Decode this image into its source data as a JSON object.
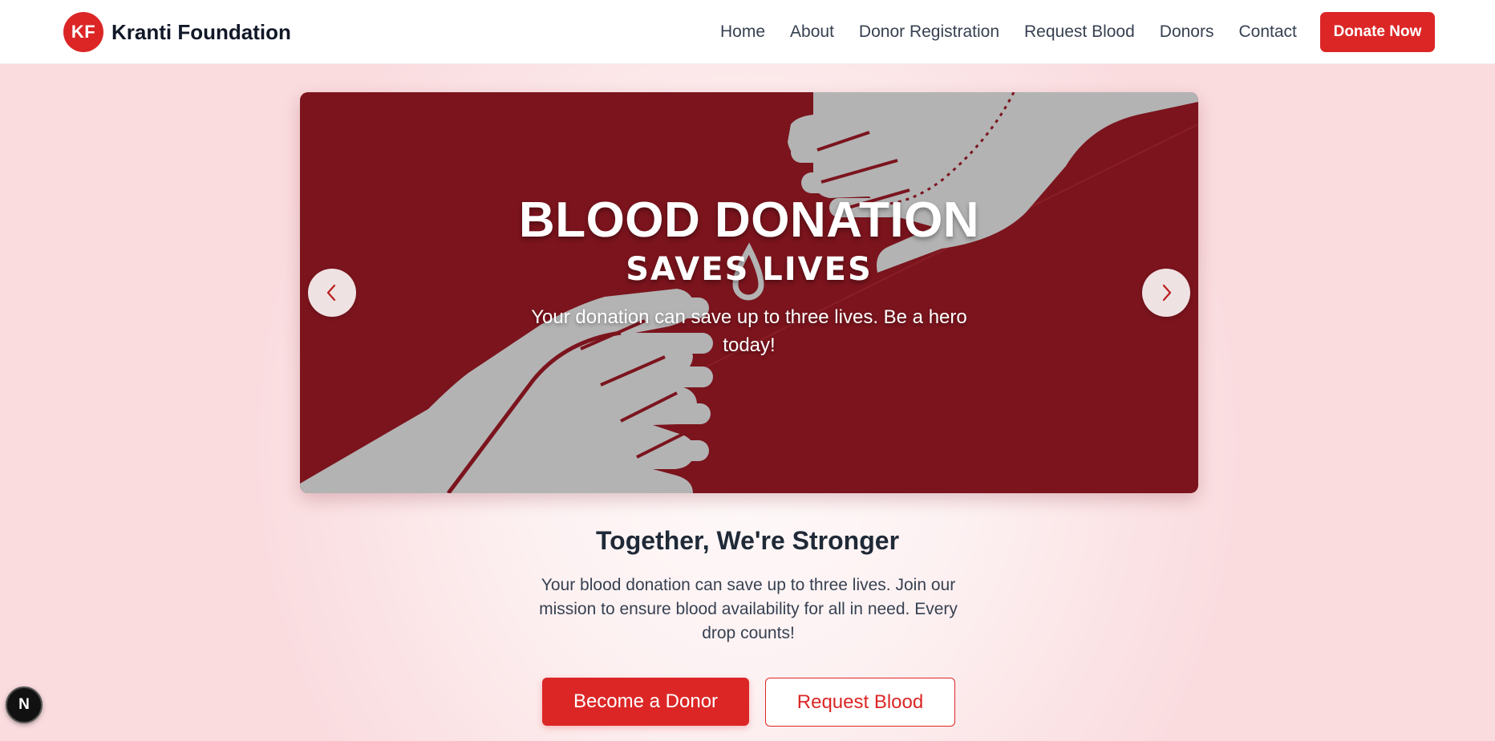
{
  "header": {
    "logo_text": "KF",
    "brand_name": "Kranti Foundation",
    "nav": [
      "Home",
      "About",
      "Donor Registration",
      "Request Blood",
      "Donors",
      "Contact"
    ],
    "cta_label": "Donate Now"
  },
  "hero": {
    "title": "BLOOD DONATION",
    "subtitle": "SAVES LIVES",
    "description": "Your donation can save up to three lives. Be a hero today!",
    "prev_icon": "chevron-left-icon",
    "next_icon": "chevron-right-icon"
  },
  "mission": {
    "title": "Together, We're Stronger",
    "text": "Your blood donation can save up to three lives. Join our mission to ensure blood availability for all in need. Every drop counts!",
    "primary_button": "Become a Donor",
    "secondary_button": "Request Blood"
  },
  "dev_badge": {
    "label": "N"
  },
  "colors": {
    "brand_red": "#dc2626",
    "hero_background": "#7b141d",
    "hand_gray": "#b3b3b3",
    "heading_text": "#1f2937"
  }
}
